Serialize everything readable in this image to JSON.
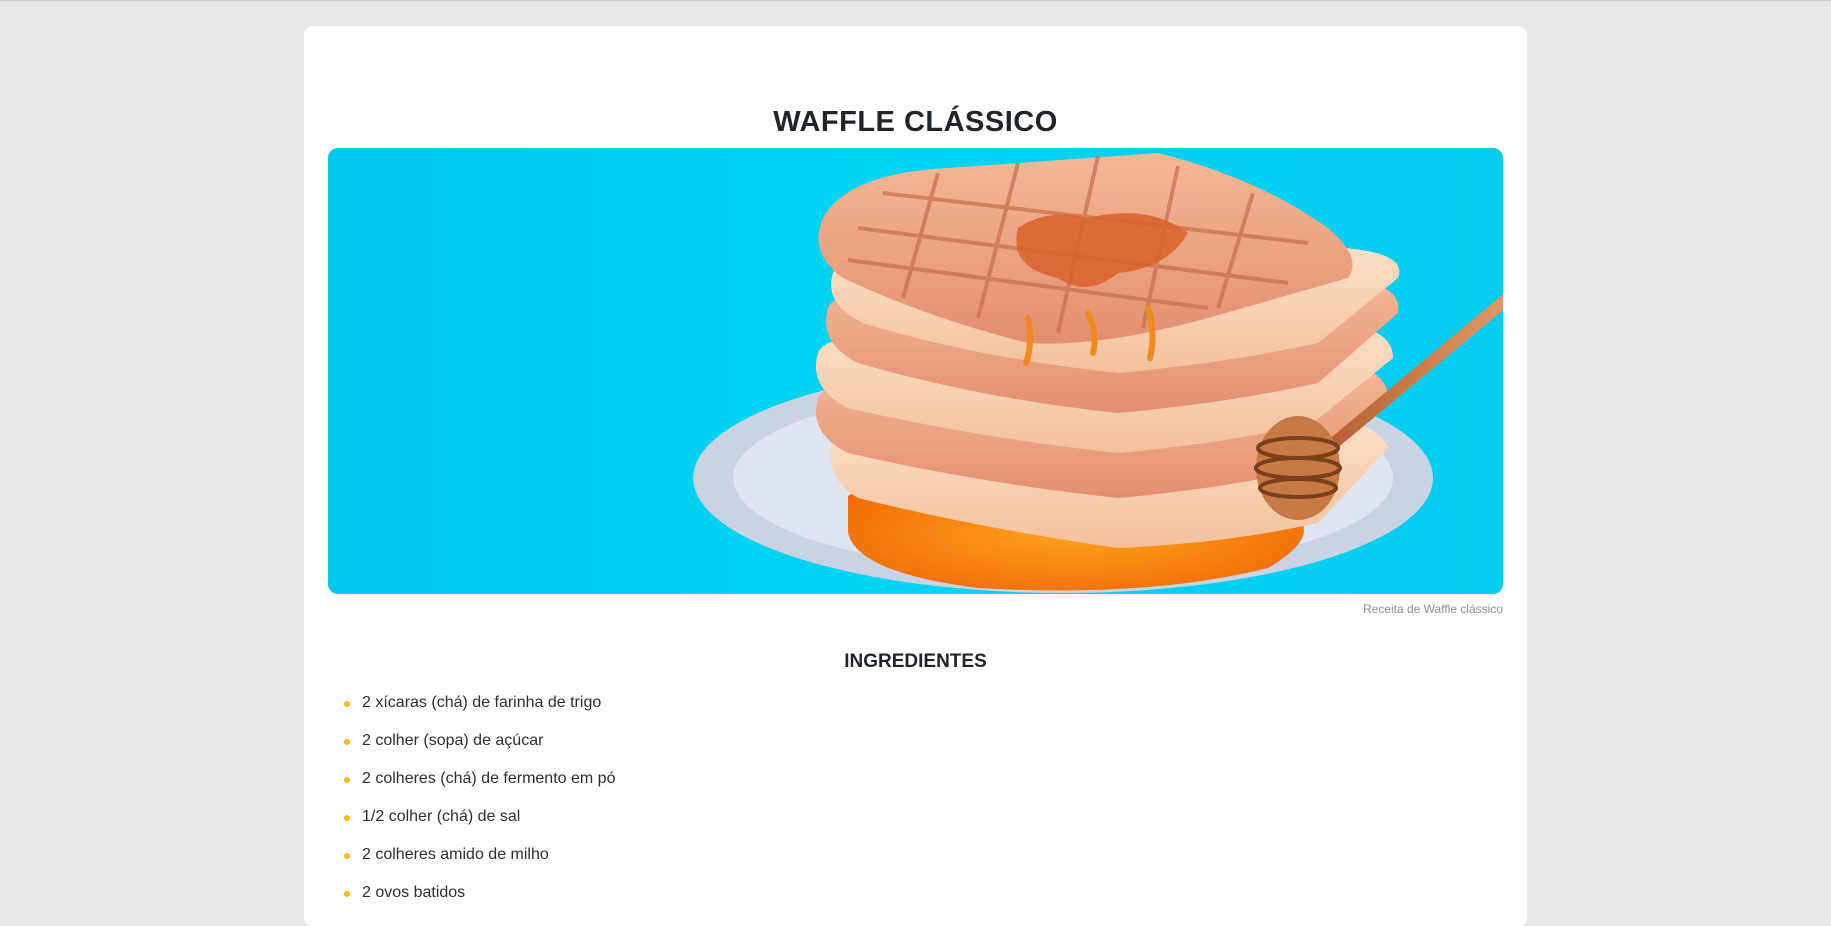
{
  "recipe": {
    "title": "WAFFLE CLÁSSICO",
    "image_caption": "Receita de Waffle clássico",
    "image_alt": "Pilha de waffles com mel em um prato sobre fundo azul"
  },
  "ingredients": {
    "heading": "INGREDIENTES",
    "items": [
      "2 xícaras (chá) de farinha de trigo",
      "2 colher (sopa) de açúcar",
      "2 colheres (chá) de fermento em pó",
      "1/2 colher (chá) de sal",
      "2 colheres amido de milho",
      "2 ovos batidos"
    ]
  },
  "colors": {
    "background": "#e8e8e8",
    "card": "#ffffff",
    "heading_text": "#1e2428",
    "bullet": "#f5b90f",
    "hero_background": "#00d4f3"
  }
}
